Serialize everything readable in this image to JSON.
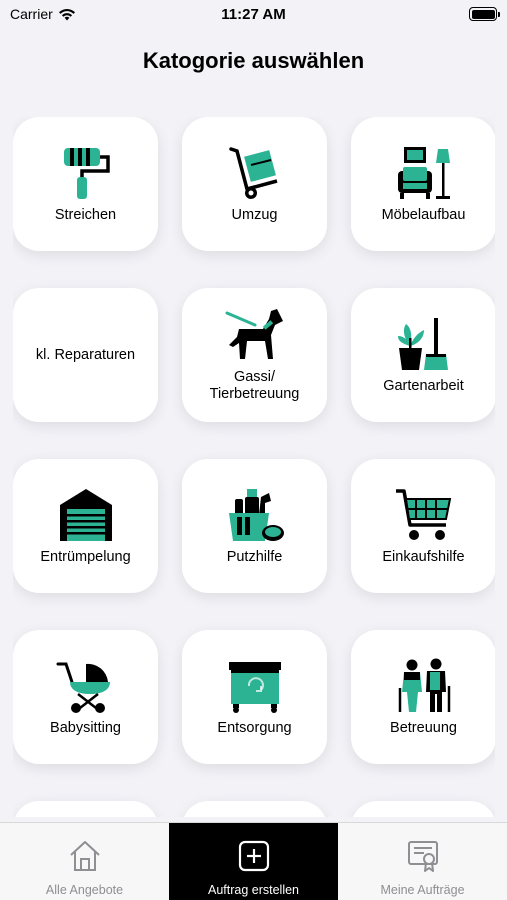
{
  "status_bar": {
    "carrier": "Carrier",
    "time": "11:27 AM"
  },
  "page": {
    "title": "Katogorie auswählen"
  },
  "categories": [
    {
      "label": "Streichen",
      "icon": "paint-roller-icon"
    },
    {
      "label": "Umzug",
      "icon": "hand-truck-icon"
    },
    {
      "label": "Möbelaufbau",
      "icon": "furniture-icon"
    },
    {
      "label": "kl. Reparaturen",
      "icon": ""
    },
    {
      "label": "Gassi/\nTierbetreuung",
      "icon": "dog-leash-icon"
    },
    {
      "label": "Gartenarbeit",
      "icon": "gardening-icon"
    },
    {
      "label": "Entrümpelung",
      "icon": "garage-icon"
    },
    {
      "label": "Putzhilfe",
      "icon": "cleaning-bucket-icon"
    },
    {
      "label": "Einkaufshilfe",
      "icon": "shopping-cart-icon"
    },
    {
      "label": "Babysitting",
      "icon": "baby-stroller-icon"
    },
    {
      "label": "Entsorgung",
      "icon": "recycling-bin-icon"
    },
    {
      "label": "Betreuung",
      "icon": "elderly-couple-icon"
    }
  ],
  "tab_bar": {
    "tabs": [
      {
        "label": "Alle Angebote",
        "icon": "house-icon",
        "active": false
      },
      {
        "label": "Auftrag erstellen",
        "icon": "plus-square-icon",
        "active": true
      },
      {
        "label": "Meine Aufträge",
        "icon": "certificate-icon",
        "active": false
      }
    ]
  },
  "colors": {
    "accent": "#2bb394",
    "icon_dark": "#000000",
    "background": "#f2f2f7",
    "tab_active_bg": "#000000",
    "tab_inactive_text": "#8e8e93"
  }
}
